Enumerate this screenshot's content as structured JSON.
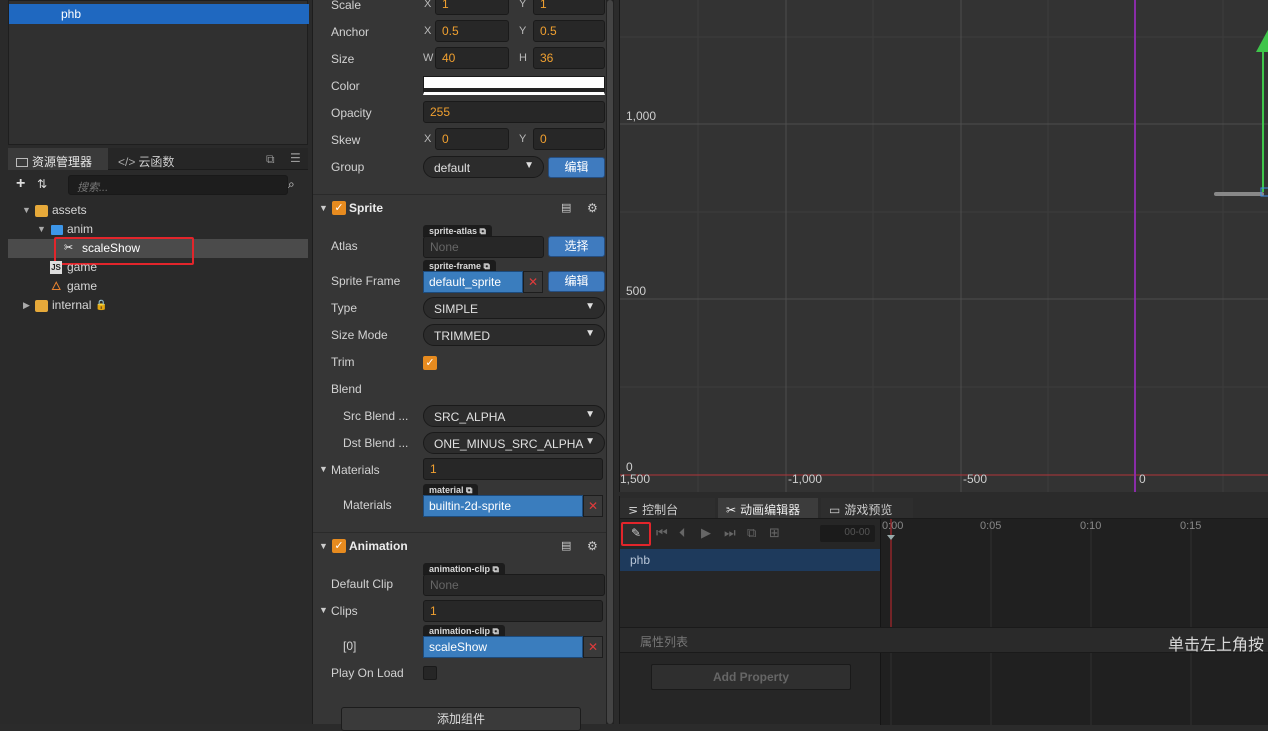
{
  "hierarchy": {
    "selected": "phb"
  },
  "assets_panel": {
    "tabs": [
      "资源管理器",
      "云函数"
    ],
    "search_placeholder": "搜索...",
    "tree": [
      {
        "label": "assets",
        "depth": 0,
        "expanded": true,
        "icon": "package-icon"
      },
      {
        "label": "anim",
        "depth": 1,
        "expanded": true,
        "icon": "folder-icon"
      },
      {
        "label": "scaleShow",
        "depth": 2,
        "icon": "animation-clip-icon",
        "selected": true
      },
      {
        "label": "game",
        "depth": 2,
        "icon": "js-file-icon"
      },
      {
        "label": "game",
        "depth": 2,
        "icon": "fire-scene-icon"
      },
      {
        "label": "internal",
        "depth": 0,
        "expanded": false,
        "icon": "package-icon",
        "locked": true
      }
    ]
  },
  "inspector": {
    "scale": {
      "label": "Scale",
      "x": "1",
      "y": "1"
    },
    "anchor": {
      "label": "Anchor",
      "x": "0.5",
      "y": "0.5"
    },
    "size": {
      "label": "Size",
      "w": "40",
      "h": "36"
    },
    "color": {
      "label": "Color",
      "value": "#ffffff"
    },
    "opacity": {
      "label": "Opacity",
      "value": "255"
    },
    "skew": {
      "label": "Skew",
      "x": "0",
      "y": "0"
    },
    "group": {
      "label": "Group",
      "value": "default",
      "edit": "编辑"
    },
    "axis": {
      "x": "X",
      "y": "Y",
      "w": "W",
      "h": "H"
    },
    "sprite": {
      "title": "Sprite",
      "atlas": {
        "label": "Atlas",
        "tag": "sprite-atlas",
        "value": "None",
        "button": "选择"
      },
      "frame": {
        "label": "Sprite Frame",
        "tag": "sprite-frame",
        "value": "default_sprite",
        "button": "编辑"
      },
      "type": {
        "label": "Type",
        "value": "SIMPLE"
      },
      "size_mode": {
        "label": "Size Mode",
        "value": "TRIMMED"
      },
      "trim": {
        "label": "Trim",
        "checked": true
      },
      "blend": {
        "label": "Blend"
      },
      "src_blend": {
        "label": "Src Blend ...",
        "value": "SRC_ALPHA"
      },
      "dst_blend": {
        "label": "Dst Blend ...",
        "value": "ONE_MINUS_SRC_ALPHA"
      },
      "materials_count": {
        "label": "Materials",
        "value": "1"
      },
      "materials": {
        "label": "Materials",
        "tag": "material",
        "value": "builtin-2d-sprite"
      }
    },
    "animation": {
      "title": "Animation",
      "default_clip": {
        "label": "Default Clip",
        "tag": "animation-clip",
        "value": "None"
      },
      "clips": {
        "label": "Clips",
        "value": "1"
      },
      "clip0": {
        "label": "[0]",
        "tag": "animation-clip",
        "value": "scaleShow"
      },
      "play_on_load": {
        "label": "Play On Load",
        "checked": false
      }
    },
    "add_component": "添加组件"
  },
  "scene": {
    "y_labels": [
      "1,000",
      "500",
      "0"
    ],
    "x_labels": [
      "1,500",
      "-1,000",
      "-500",
      "0"
    ]
  },
  "bottom_panel": {
    "tabs": [
      "控制台",
      "动画编辑器",
      "游戏预览"
    ],
    "time_field": "00-00",
    "ticks": [
      "0:00",
      "0:05",
      "0:10",
      "0:15"
    ],
    "node": "phb",
    "property_list": "属性列表",
    "add_property": "Add Property",
    "hint": "单击左上角按"
  },
  "colors": {
    "accent": "#e78b1f",
    "selection": "#1f68c0",
    "button": "#3f7bbf",
    "highlight": "#e2252b"
  }
}
